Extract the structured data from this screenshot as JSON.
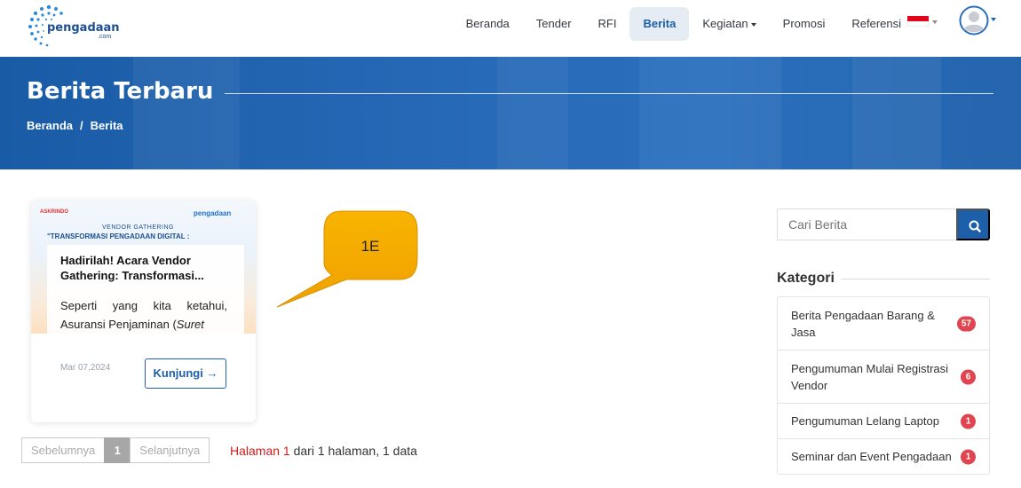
{
  "brand": {
    "name": "pengadaan",
    "suffix": ".com"
  },
  "nav": {
    "items": [
      {
        "label": "Beranda",
        "active": false,
        "dropdown": false
      },
      {
        "label": "Tender",
        "active": false,
        "dropdown": false
      },
      {
        "label": "RFI",
        "active": false,
        "dropdown": false
      },
      {
        "label": "Berita",
        "active": true,
        "dropdown": false
      },
      {
        "label": "Kegiatan",
        "active": false,
        "dropdown": true
      },
      {
        "label": "Promosi",
        "active": false,
        "dropdown": false
      },
      {
        "label": "Referensi",
        "active": false,
        "dropdown": false
      }
    ]
  },
  "hero": {
    "title": "Berita Terbaru",
    "breadcrumb": [
      "Beranda",
      "/",
      "Berita"
    ]
  },
  "card": {
    "image": {
      "logo_left": "ASKRINDO",
      "logo_right": "pengadaan",
      "subheading": "VENDOR GATHERING",
      "heading": "\"TRANSFORMASI PENGADAAN DIGITAL :"
    },
    "title": "Hadirilah! Acara Vendor Gathering: Transformasi...",
    "desc_plain": "Seperti yang kita ketahui, Asuransi Penjaminan (",
    "desc_italic": "Suret",
    "date": "Mar 07,2024",
    "button": "Kunjungi →"
  },
  "callout": {
    "label": "1E",
    "color": "#f5a800"
  },
  "pagination": {
    "prev": "Sebelumnya",
    "current": "1",
    "next": "Selanjutnya",
    "info_red": "Halaman 1",
    "info_rest": " dari 1 halaman, 1 data"
  },
  "sidebar": {
    "search_placeholder": "Cari Berita",
    "category_title": "Kategori",
    "categories": [
      {
        "label": "Berita Pengadaan Barang & Jasa",
        "count": "57"
      },
      {
        "label": "Pengumuman Mulai Registrasi Vendor",
        "count": "6"
      },
      {
        "label": "Pengumuman Lelang Laptop",
        "count": "1"
      },
      {
        "label": "Seminar dan Event Pengadaan",
        "count": "1"
      }
    ]
  },
  "colors": {
    "primary": "#1d5fa8",
    "badge": "#e0454f",
    "hero": "#2668b5"
  }
}
